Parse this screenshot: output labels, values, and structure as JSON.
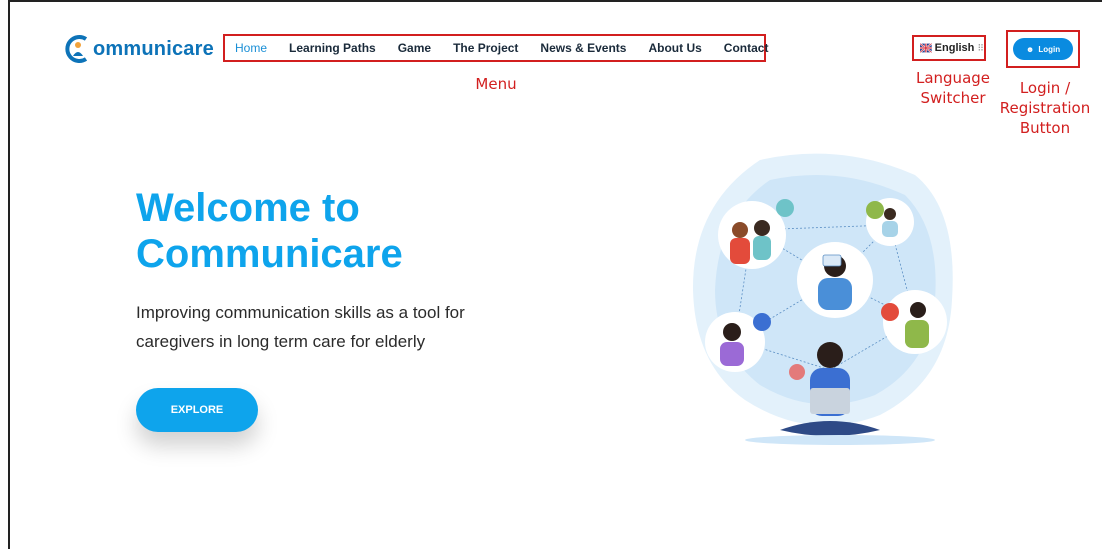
{
  "brand": {
    "name": "ommunicare",
    "logo_icon": "communicare-logo-icon",
    "color": "#0d73b8"
  },
  "menu": {
    "items": [
      {
        "label": "Home",
        "active": true
      },
      {
        "label": "Learning Paths"
      },
      {
        "label": "Game"
      },
      {
        "label": "The Project"
      },
      {
        "label": "News & Events"
      },
      {
        "label": "About Us"
      },
      {
        "label": "Contact"
      }
    ],
    "accent": "#1a8fd6"
  },
  "language": {
    "label": "English",
    "flag_icon": "uk-flag-icon",
    "grid_icon": "grid-icon"
  },
  "login": {
    "label": "Login",
    "icon": "user-icon",
    "color": "#0a8be0"
  },
  "annotations": {
    "menu": "Menu",
    "language_line1": "Language",
    "language_line2": "Switcher",
    "login_line1": "Login /",
    "login_line2": "Registration",
    "login_line3": "Button",
    "color": "#d21f1f"
  },
  "hero": {
    "title_line1": "Welcome to",
    "title_line2": "Communicare",
    "subtitle_line1": "Improving communication skills as a tool for",
    "subtitle_line2": "caregivers in long term care for elderly",
    "cta": "EXPLORE",
    "accent": "#0ea4ec"
  }
}
